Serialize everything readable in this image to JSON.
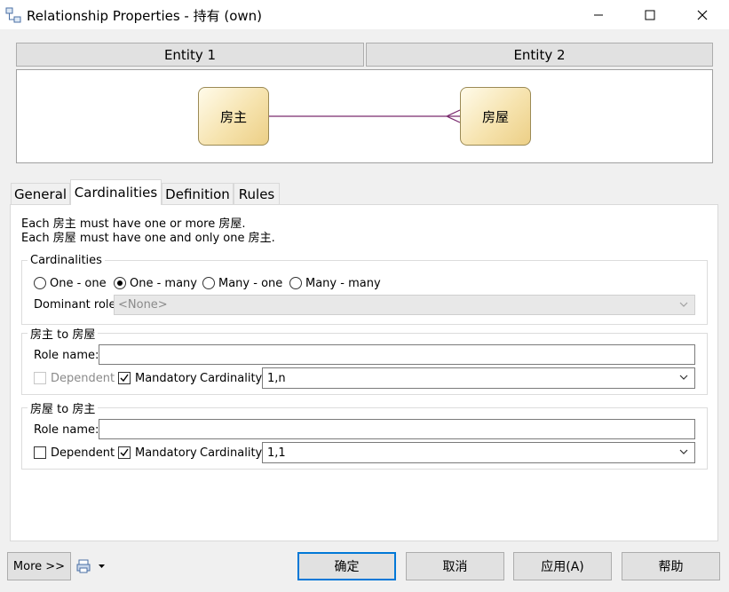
{
  "window": {
    "title": "Relationship Properties - 持有 (own)"
  },
  "entity_headers": {
    "entity1": "Entity 1",
    "entity2": "Entity 2"
  },
  "diagram": {
    "entity1_name": "房主",
    "entity2_name": "房屋"
  },
  "tabs": [
    {
      "label": "General"
    },
    {
      "label": "Cardinalities"
    },
    {
      "label": "Definition"
    },
    {
      "label": "Rules"
    }
  ],
  "active_tab": "Cardinalities",
  "description": {
    "line1": "Each 房主 must have one or more 房屋.",
    "line2": "Each 房屋 must have one and only one 房主."
  },
  "cardinalities_group": {
    "legend": "Cardinalities",
    "options": [
      "One - one",
      "One - many",
      "Many - one",
      "Many - many"
    ],
    "selected": "One - many",
    "dominant_role_label": "Dominant role:",
    "dominant_role_value": "<None>"
  },
  "role_a_to_b": {
    "legend": "房主 to 房屋",
    "role_name_label": "Role name:",
    "role_name_value": "",
    "dependent_label": "Dependent",
    "dependent_checked": false,
    "dependent_enabled": false,
    "mandatory_label": "Mandatory",
    "mandatory_checked": true,
    "cardinality_label": "Cardinality:",
    "cardinality_value": "1,n"
  },
  "role_b_to_a": {
    "legend": "房屋 to 房主",
    "role_name_label": "Role name:",
    "role_name_value": "",
    "dependent_label": "Dependent",
    "dependent_checked": false,
    "dependent_enabled": true,
    "mandatory_label": "Mandatory",
    "mandatory_checked": true,
    "cardinality_label": "Cardinality:",
    "cardinality_value": "1,1"
  },
  "buttons": {
    "more": "More >>",
    "ok": "确定",
    "cancel": "取消",
    "apply": "应用(A)",
    "help": "帮助"
  },
  "colors": {
    "relationship_line": "#7a2a6e",
    "entity_fill": "#f6e3ae",
    "default_button_border": "#0078d7"
  }
}
